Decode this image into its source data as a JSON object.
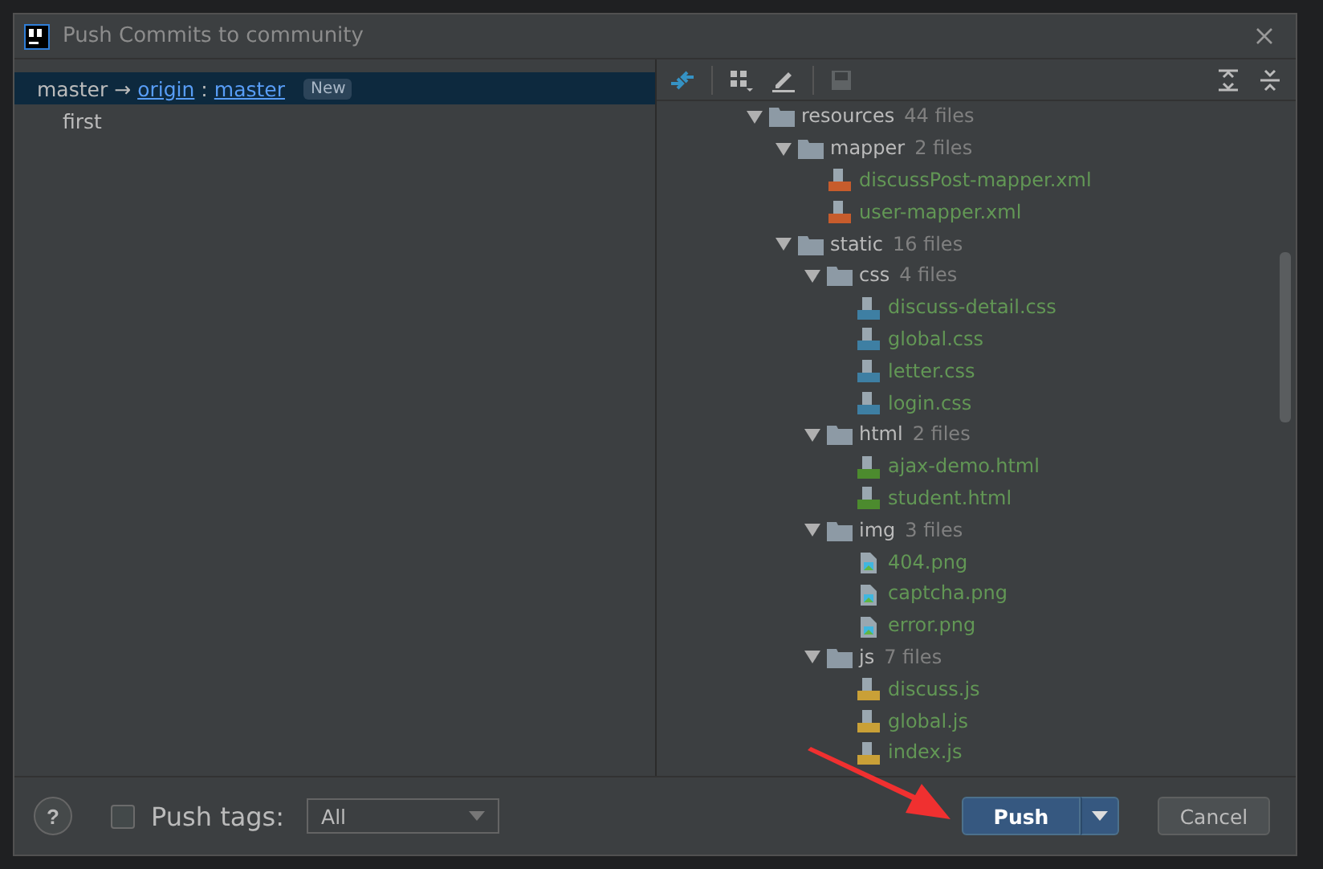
{
  "window": {
    "title": "Push Commits to community"
  },
  "commits": {
    "branch": {
      "local": "master",
      "arrow": "→",
      "remote": "origin",
      "separator": ":",
      "target": "master",
      "badge": "New",
      "selected": true
    },
    "items": [
      {
        "label": "first",
        "selected": false
      }
    ]
  },
  "tree": [
    {
      "kind": "folder",
      "name": "resources",
      "count": "44 files",
      "expanded": true,
      "children": [
        {
          "kind": "folder",
          "name": "mapper",
          "count": "2 files",
          "expanded": true,
          "children": [
            {
              "kind": "xml",
              "name": "discussPost-mapper.xml"
            },
            {
              "kind": "xml",
              "name": "user-mapper.xml"
            }
          ]
        },
        {
          "kind": "folder",
          "name": "static",
          "count": "16 files",
          "expanded": true,
          "children": [
            {
              "kind": "folder",
              "name": "css",
              "count": "4 files",
              "expanded": true,
              "children": [
                {
                  "kind": "css",
                  "name": "discuss-detail.css"
                },
                {
                  "kind": "css",
                  "name": "global.css"
                },
                {
                  "kind": "css",
                  "name": "letter.css"
                },
                {
                  "kind": "css",
                  "name": "login.css"
                }
              ]
            },
            {
              "kind": "folder",
              "name": "html",
              "count": "2 files",
              "expanded": true,
              "children": [
                {
                  "kind": "html",
                  "name": "ajax-demo.html"
                },
                {
                  "kind": "html",
                  "name": "student.html"
                }
              ]
            },
            {
              "kind": "folder",
              "name": "img",
              "count": "3 files",
              "expanded": true,
              "children": [
                {
                  "kind": "png",
                  "name": "404.png"
                },
                {
                  "kind": "png",
                  "name": "captcha.png"
                },
                {
                  "kind": "png",
                  "name": "error.png"
                }
              ]
            },
            {
              "kind": "folder",
              "name": "js",
              "count": "7 files",
              "expanded": true,
              "children": [
                {
                  "kind": "js",
                  "name": "discuss.js"
                },
                {
                  "kind": "js",
                  "name": "global.js"
                },
                {
                  "kind": "js",
                  "name": "index.js"
                }
              ]
            }
          ]
        }
      ]
    }
  ],
  "footer": {
    "help": "?",
    "push_tags": {
      "label": "Push tags:",
      "checked": false,
      "value": "All"
    },
    "buttons": [
      {
        "kind": "primary",
        "label": "Push"
      },
      {
        "kind": "secondary",
        "label": "Cancel"
      }
    ]
  }
}
